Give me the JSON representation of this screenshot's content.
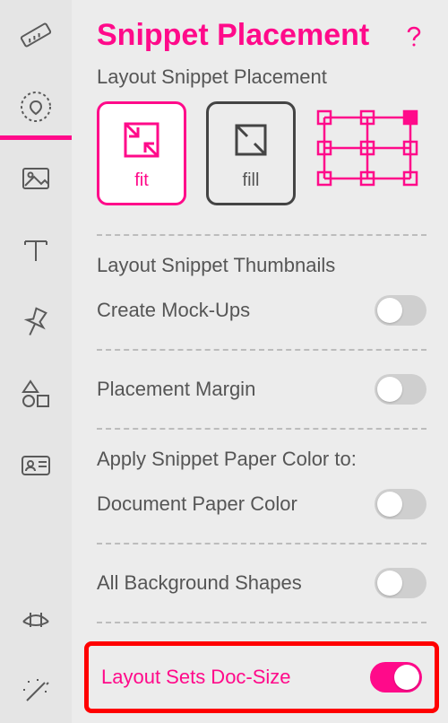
{
  "colors": {
    "accent": "#ff0a8a",
    "highlight_border": "#ff0000"
  },
  "sidebar": {
    "items": [
      {
        "name": "ruler-icon",
        "active": false
      },
      {
        "name": "favorite-icon",
        "active": true
      },
      {
        "name": "image-icon",
        "active": false
      },
      {
        "name": "text-icon",
        "active": false
      },
      {
        "name": "pin-icon",
        "active": false
      },
      {
        "name": "shapes-icon",
        "active": false
      },
      {
        "name": "id-card-icon",
        "active": false
      }
    ],
    "bottom_items": [
      {
        "name": "diagram-icon",
        "active": false
      },
      {
        "name": "wand-icon",
        "active": false
      }
    ]
  },
  "panel": {
    "title": "Snippet Placement",
    "help_icon": "help-icon",
    "sections": {
      "placement_label": "Layout Snippet Placement",
      "fit_label": "fit",
      "fill_label": "fill",
      "placement_selected": "fit",
      "thumbnails_label": "Layout Snippet Thumbnails",
      "mockups_label": "Create Mock-Ups",
      "mockups_on": false,
      "margin_label": "Placement Margin",
      "margin_on": false,
      "apply_paper_label": "Apply Snippet Paper Color to:",
      "doc_paper_label": "Document Paper Color",
      "doc_paper_on": false,
      "bg_shapes_label": "All Background Shapes",
      "bg_shapes_on": false,
      "docsize_label": "Layout Sets Doc-Size",
      "docsize_on": true
    }
  }
}
